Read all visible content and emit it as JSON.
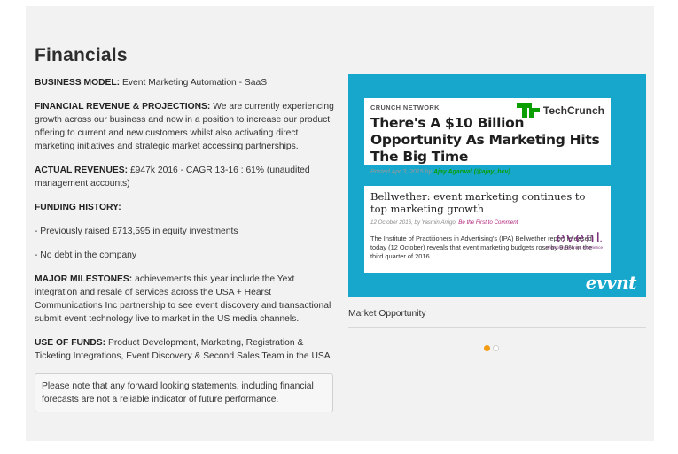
{
  "section": {
    "title": "Financials"
  },
  "business_model": {
    "label": "BUSINESS MODEL:",
    "text": "Event Marketing Automation - SaaS"
  },
  "revenue_projections": {
    "label": "FINANCIAL REVENUE & PROJECTIONS:",
    "text": "We are currently experiencing growth across our business and now in a position to increase our product offering to current and new customers whilst also activating direct marketing initiatives and strategic market accessing partnerships."
  },
  "actual_revenues": {
    "label": "ACTUAL REVENUES:",
    "text": "£947k 2016 - CAGR 13-16 : 61% (unaudited management accounts)"
  },
  "funding_history": {
    "label": "FUNDING HISTORY:",
    "items": [
      "- Previously raised £713,595 in equity investments",
      "- No debt in the company"
    ]
  },
  "major_milestones": {
    "label": "MAJOR MILESTONES:",
    "text": "achievements this year include the Yext integration and resale of services across the USA + Hearst Communications Inc partnership to see event discovery and transactional submit event technology live to market in the US media channels."
  },
  "use_of_funds": {
    "label": "USE OF FUNDS:",
    "text": "Product Development, Marketing, Registration & Ticketing Integrations, Event Discovery & Second Sales Team in the USA"
  },
  "disclaimer": "Please note that any forward looking statements, including financial forecasts are not a reliable indicator of future performance.",
  "slide": {
    "techcrunch": {
      "network": "CRUNCH NETWORK",
      "logo_text": "TechCrunch",
      "headline": "There's A $10 Billion Opportunity As Marketing Hits The Big Time",
      "byline_prefix": "Posted Apr 3, 2015 by",
      "byline_author": "Ajay Agarwal (@ajay_bcv)"
    },
    "bellwether": {
      "headline": "Bellwether: event marketing continues to top marketing growth",
      "byline_prefix": "12 October 2016, by Yasmin Arrigo,",
      "byline_link": "Be the First to Comment",
      "logo_word": "event",
      "logo_tagline": "Championing brand experience",
      "body": "The Institute of Practitioners in Advertising's (IPA) Bellwether report released today (12 October) reveals that event marketing budgets rose by 9.9% in the third quarter of 2016."
    },
    "brand": "evvnt",
    "caption": "Market Opportunity"
  },
  "carousel": {
    "count": 2,
    "active_index": 0,
    "active_color": "#f39c12"
  },
  "colors": {
    "slide_background": "#17a7cc",
    "techcrunch_green": "#0a9e01",
    "event_purple": "#7a2f7a"
  }
}
